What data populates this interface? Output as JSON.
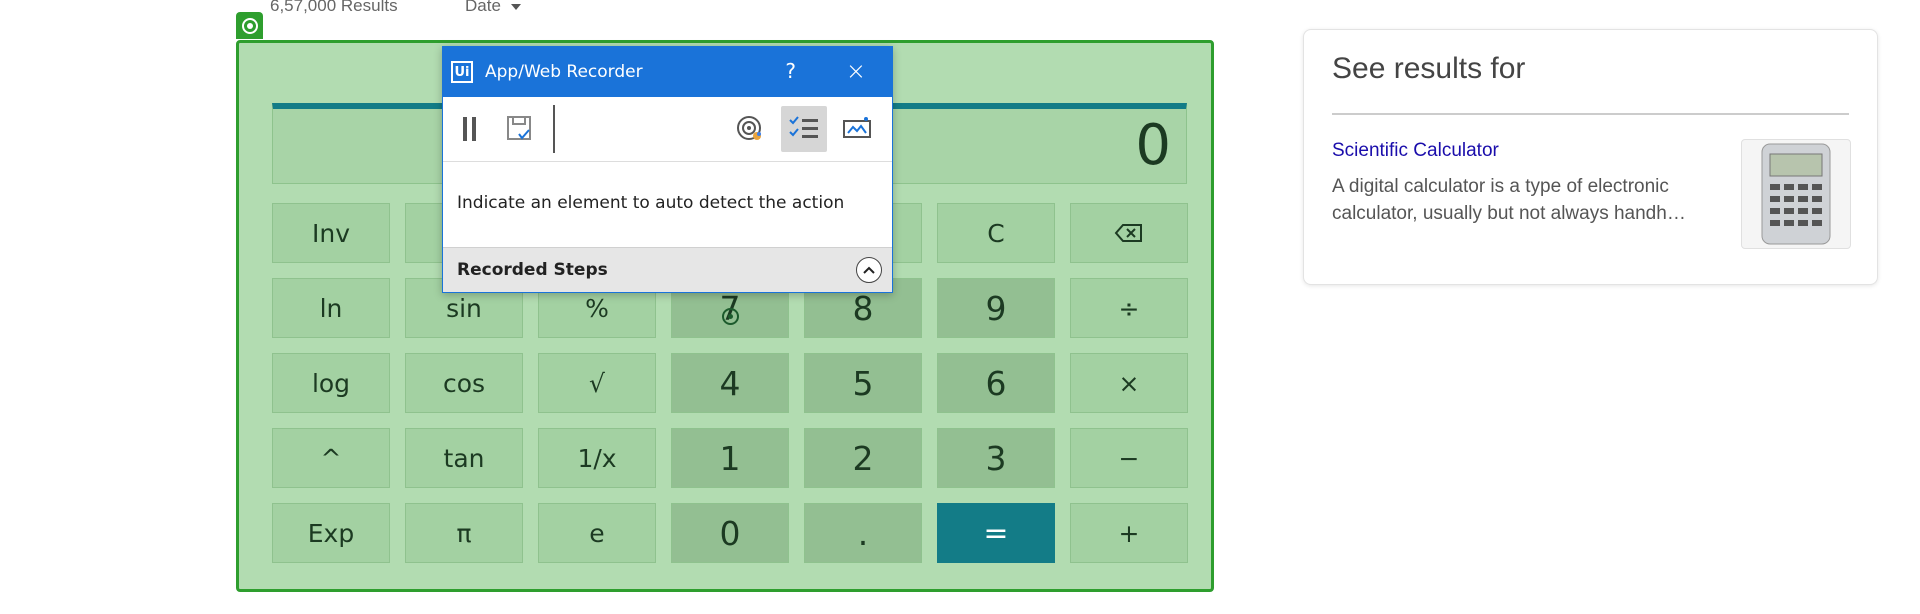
{
  "search": {
    "results_count": "6,57,000 Results",
    "date_filter": "Date"
  },
  "calculator": {
    "display": "0",
    "keys": [
      [
        "Inv",
        "",
        "",
        "",
        "",
        "C",
        ""
      ],
      [
        "ln",
        "sin",
        "%",
        "7",
        "8",
        "9",
        "÷"
      ],
      [
        "log",
        "cos",
        "√",
        "4",
        "5",
        "6",
        "×"
      ],
      [
        "^",
        "tan",
        "1/x",
        "1",
        "2",
        "3",
        "−"
      ],
      [
        "Exp",
        "π",
        "e",
        "0",
        ".",
        "=",
        "+"
      ]
    ],
    "colors": {
      "accent": "#137c87",
      "highlight_border": "#2e9e2e"
    }
  },
  "recorder": {
    "title": "App/Web Recorder",
    "logo": "Ui",
    "help": "?",
    "close": "×",
    "instruction": "Indicate an element to auto detect the action",
    "steps_label": "Recorded Steps",
    "toolbar_icons": [
      "pause-icon",
      "save-icon",
      "target-icon",
      "checklist-icon",
      "screen-scan-icon"
    ],
    "accent": "#1a73d9"
  },
  "results_panel": {
    "title": "See results for",
    "link": "Scientific Calculator",
    "description": "A digital calculator is a type of electronic calculator, usually but not always handh…",
    "thumbnail_icon": "calculator-image"
  }
}
